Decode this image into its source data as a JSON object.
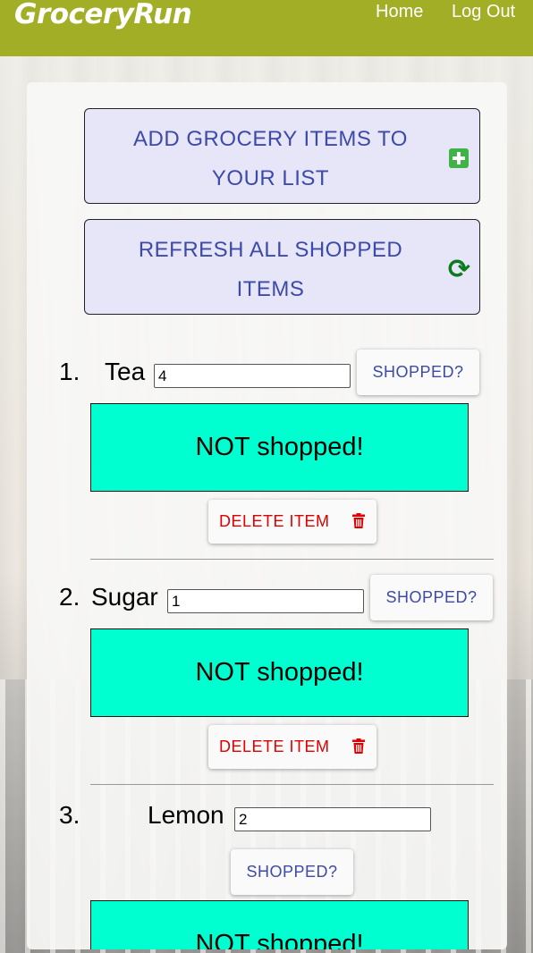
{
  "nav": {
    "brand": "GroceryRun",
    "home": "Home",
    "logout": "Log Out"
  },
  "actions": {
    "add_label": "ADD GROCERY ITEMS TO YOUR LIST",
    "refresh_label": "REFRESH ALL SHOPPED ITEMS"
  },
  "items": [
    {
      "number": "1.",
      "name": "Tea",
      "quantity": "4",
      "shopped_label": "SHOPPED?",
      "status": "NOT shopped!",
      "delete_label": "DELETE ITEM"
    },
    {
      "number": "2.",
      "name": "Sugar",
      "quantity": "1",
      "shopped_label": "SHOPPED?",
      "status": "NOT shopped!",
      "delete_label": "DELETE ITEM"
    },
    {
      "number": "3.",
      "name": "Lemon",
      "quantity": "2",
      "shopped_label": "SHOPPED?",
      "status": "NOT shopped!"
    }
  ],
  "colors": {
    "navbar": "#a2af26",
    "status_bg": "#00ffd0",
    "button_text": "#3d4aa8",
    "delete_text": "#e00000",
    "plus_icon": "#40b347",
    "refresh_icon": "#0c7a1e"
  }
}
